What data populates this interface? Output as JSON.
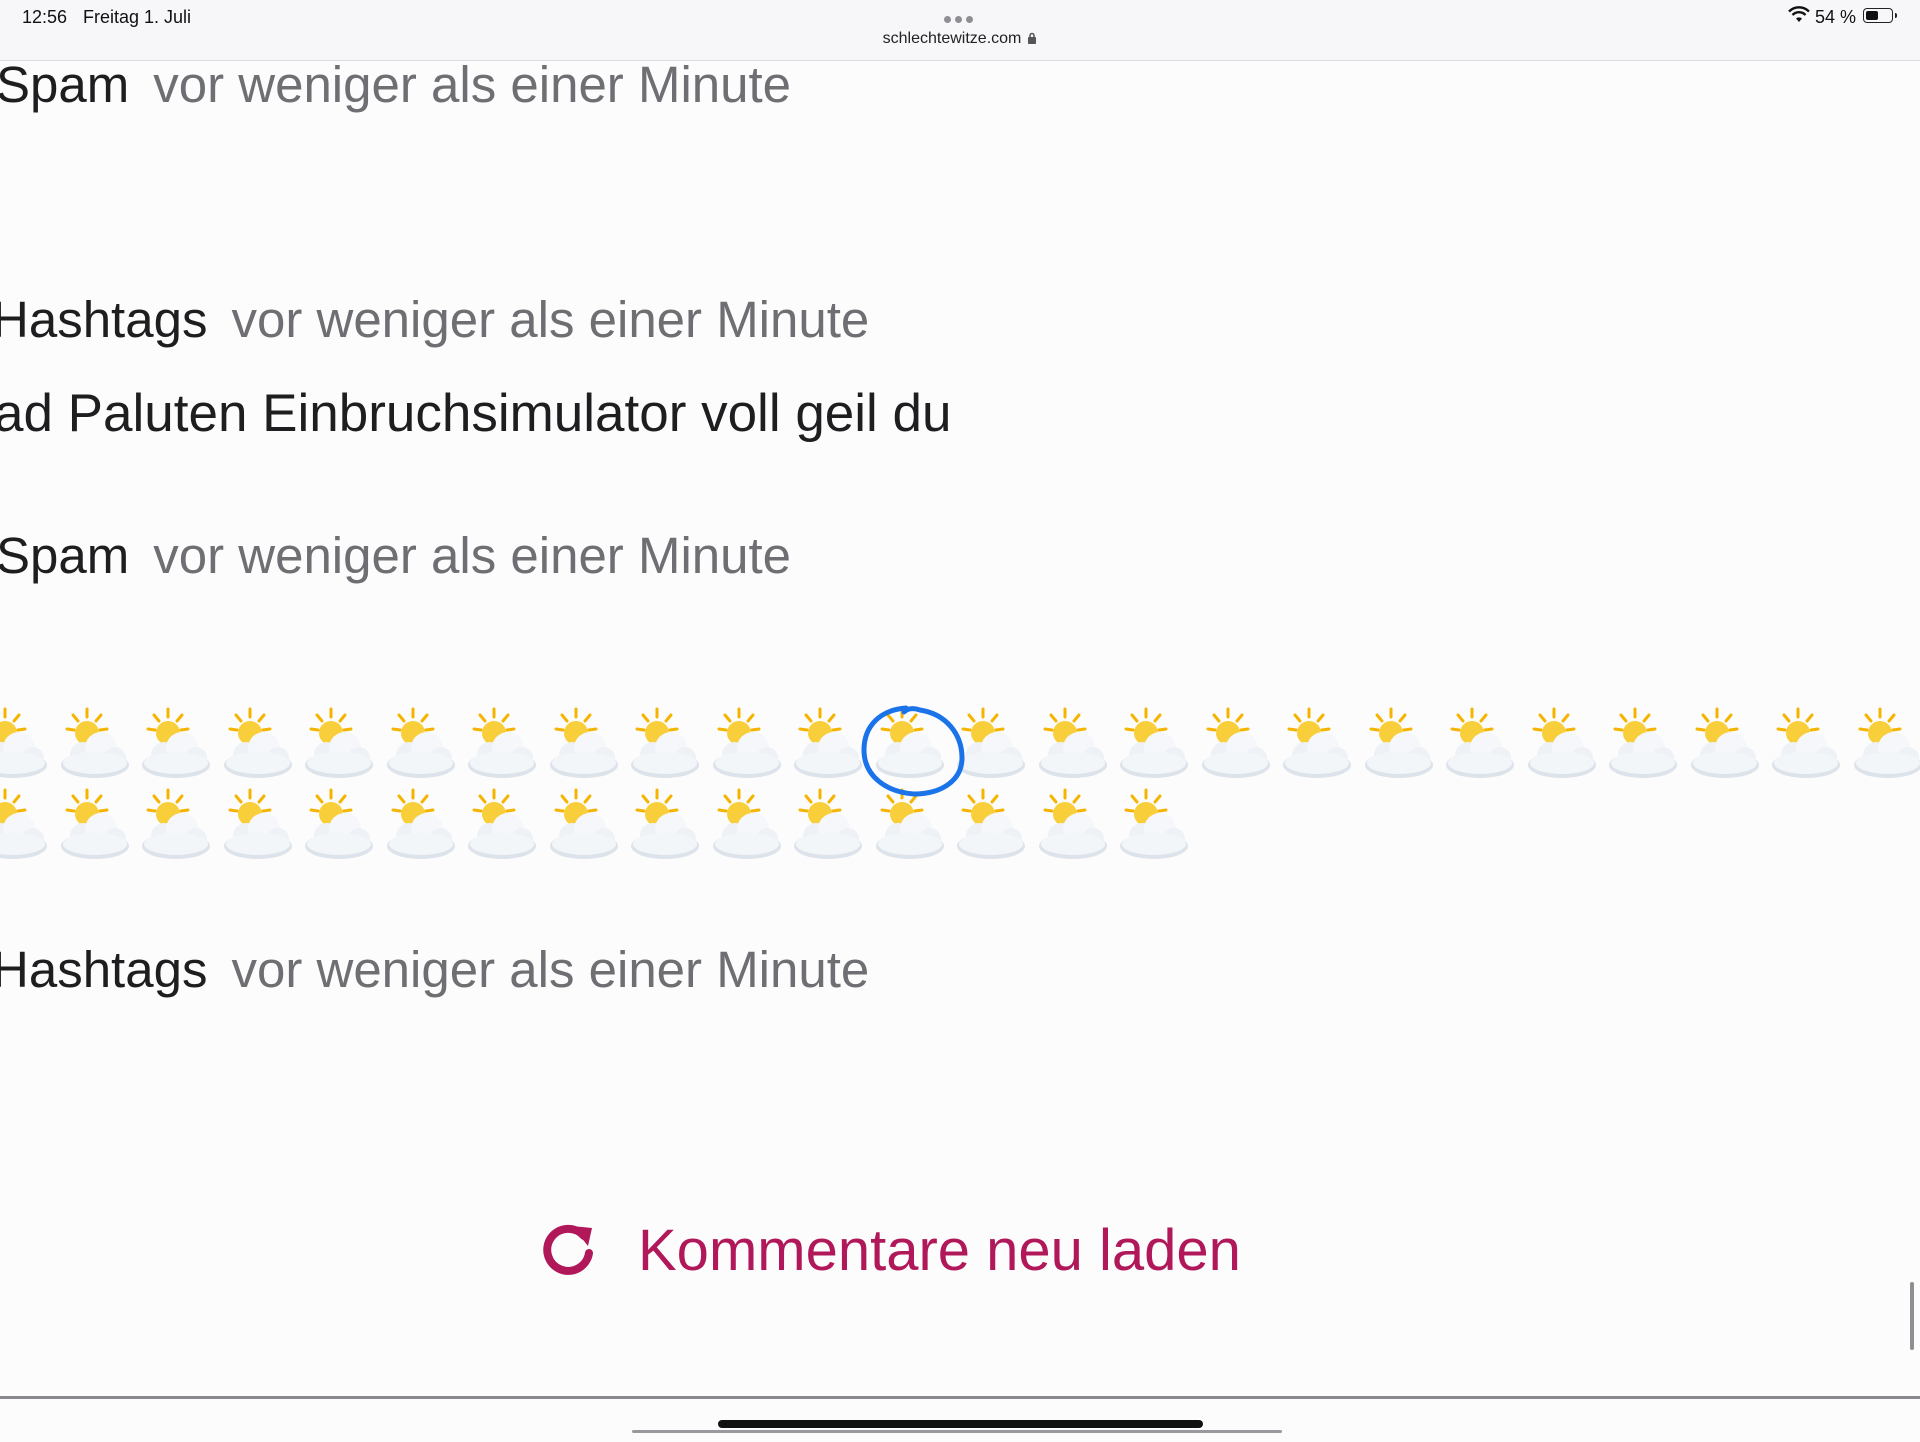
{
  "status_bar": {
    "time": "12:56",
    "date": "Freitag 1. Juli",
    "url": "schlechtewitze.com",
    "battery": "54 %",
    "battery_level": 0.54
  },
  "comments": [
    {
      "author": "Spam",
      "timestamp": "vor weniger als einer Minute",
      "body": ""
    },
    {
      "author": "Hashtags",
      "timestamp": "vor weniger als einer Minute",
      "body": "ad Paluten Einbruchsimulator voll geil du"
    },
    {
      "author": "Spam",
      "timestamp": "vor weniger als einer Minute",
      "body_emoji": "sun-behind-cloud-emoji",
      "emoji_rows": [
        24,
        15
      ]
    },
    {
      "author": "Hashtags",
      "timestamp": "vor weniger als einer Minute",
      "body": ""
    }
  ],
  "reload_button": {
    "label": "Kommentare neu laden",
    "icon": "refresh-icon",
    "color": "#b0185a"
  },
  "highlight": {
    "color": "#1a73e8",
    "description": ""
  }
}
